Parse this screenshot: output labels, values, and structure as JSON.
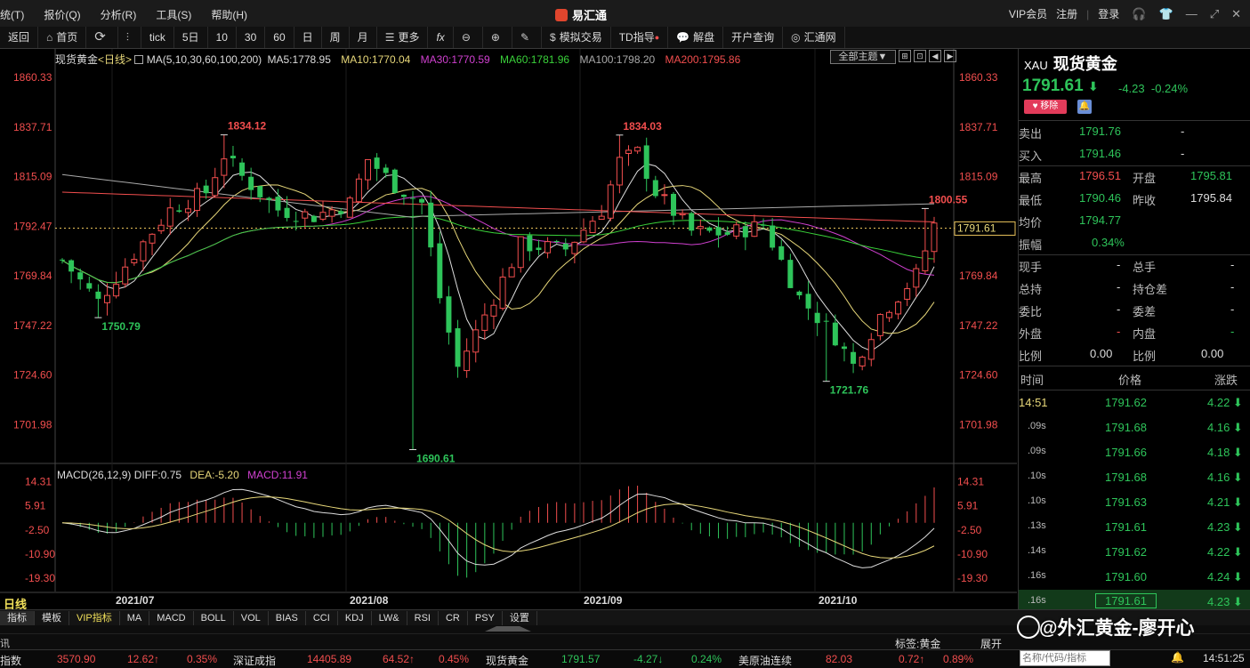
{
  "menu": [
    "统(T)",
    "报价(Q)",
    "分析(R)",
    "工具(S)",
    "帮助(H)"
  ],
  "app_title": "易汇通",
  "title_right": {
    "vip": "VIP会员",
    "register": "注册",
    "login": "登录"
  },
  "toolbar": {
    "items": [
      "返回",
      "首页",
      "",
      "",
      "tick",
      "5日",
      "10",
      "30",
      "60",
      "日",
      "周",
      "月",
      "更多",
      "fx",
      "",
      "",
      "",
      "模拟交易",
      "TD指导",
      "解盘",
      "开户查询",
      "汇通网"
    ]
  },
  "chart_header": {
    "symbol": "现货黄金",
    "period": "<日线>",
    "ma_label": "MA(5,10,30,60,100,200)",
    "ma5": "MA5:1778.95",
    "ma10": "MA10:1770.04",
    "ma30": "MA30:1770.59",
    "ma60": "MA60:1781.96",
    "ma100": "MA100:1798.20",
    "ma200": "MA200:1795.86",
    "theme_button": "全部主题▼"
  },
  "macd_header": {
    "label": "MACD(26,12,9)",
    "diff": "DIFF:0.75",
    "dea": "DEA:-5.20",
    "macd": "MACD:11.91"
  },
  "chart_data": {
    "type": "candlestick",
    "y_ticks": [
      "1860.33",
      "1837.71",
      "1815.09",
      "1792.47",
      "1769.84",
      "1747.22",
      "1724.60",
      "1701.98"
    ],
    "ylim": [
      1690,
      1866
    ],
    "x_labels": [
      "2021/07",
      "2021/08",
      "2021/09",
      "2021/10"
    ],
    "annotations": [
      {
        "text": "1834.12",
        "value": 1834.12,
        "idx": 18,
        "color": "red",
        "pos": "above"
      },
      {
        "text": "1750.79",
        "value": 1750.79,
        "idx": 4,
        "color": "green",
        "pos": "below"
      },
      {
        "text": "1690.61",
        "value": 1690.61,
        "idx": 39,
        "color": "green",
        "pos": "below"
      },
      {
        "text": "1834.03",
        "value": 1834.03,
        "idx": 62,
        "color": "red",
        "pos": "above"
      },
      {
        "text": "1800.55",
        "value": 1800.55,
        "idx": 96,
        "color": "red",
        "pos": "above"
      },
      {
        "text": "1721.76",
        "value": 1721.76,
        "idx": 85,
        "color": "green",
        "pos": "below"
      }
    ],
    "current_price": "1791.61",
    "current_value": 1791.61,
    "macd_ticks": [
      "14.31",
      "5.91",
      "-2.50",
      "-10.90",
      "-19.30"
    ],
    "macd_ylim": [
      -24,
      17
    ]
  },
  "quote": {
    "code": "XAU",
    "name": "现货黄金",
    "price": "1791.61",
    "arrow": "⬇",
    "change": "-4.23",
    "change_pct": "-0.24%",
    "remove_btn": "移除",
    "sell_label": "卖出",
    "sell": "1791.76",
    "sell_vol": "-",
    "buy_label": "买入",
    "buy": "1791.46",
    "buy_vol": "-",
    "high_label": "最高",
    "high": "1796.51",
    "open_label": "开盘",
    "open": "1795.81",
    "low_label": "最低",
    "low": "1790.46",
    "prev_label": "昨收",
    "prev": "1795.84",
    "avg_label": "均价",
    "avg": "1794.77",
    "amp_label": "振幅",
    "amp": "0.34%",
    "cur_hand_label": "现手",
    "cur_hand": "-",
    "total_hand_label": "总手",
    "total_hand": "-",
    "total_pos_label": "总持",
    "total_pos": "-",
    "pos_diff_label": "持仓差",
    "pos_diff": "-",
    "ratio_label": "委比",
    "ratio": "-",
    "diff_label": "委差",
    "diff": "-",
    "outer_label": "外盘",
    "outer": "-",
    "inner_label": "内盘",
    "inner": "-",
    "bili1_label": "比例",
    "bili1": "0.00",
    "bili2_label": "比例",
    "bili2": "0.00",
    "ticks_header": [
      "时间",
      "价格",
      "涨跌"
    ],
    "ticks": [
      {
        "time": "14:51",
        "price": "1791.62",
        "chg": "4.22"
      },
      {
        "time": ".09s",
        "price": "1791.68",
        "chg": "4.16"
      },
      {
        "time": ".09s",
        "price": "1791.66",
        "chg": "4.18"
      },
      {
        "time": ".10s",
        "price": "1791.68",
        "chg": "4.16"
      },
      {
        "time": ".10s",
        "price": "1791.63",
        "chg": "4.21"
      },
      {
        "time": ".13s",
        "price": "1791.61",
        "chg": "4.23"
      },
      {
        "time": ".14s",
        "price": "1791.62",
        "chg": "4.22"
      },
      {
        "time": ".16s",
        "price": "1791.60",
        "chg": "4.24"
      },
      {
        "time": ".16s",
        "price": "1791.61",
        "chg": "4.23"
      }
    ]
  },
  "period_tab": "日线",
  "indicator_tabs": [
    "指标",
    "模板",
    "VIP指标",
    "MA",
    "MACD",
    "BOLL",
    "VOL",
    "BIAS",
    "CCI",
    "KDJ",
    "LW&",
    "RSI",
    "CR",
    "PSY",
    "设置"
  ],
  "status": {
    "tag": "标签:黄金",
    "expand": "展开"
  },
  "search_placeholder": "名称/代码/指标",
  "watermark": "@外汇黄金-廖开心",
  "ticker": [
    {
      "t": "指数",
      "c": "white"
    },
    {
      "t": "3570.90",
      "c": "red"
    },
    {
      "t": "12.62↑",
      "c": "red"
    },
    {
      "t": "0.35%",
      "c": "red"
    },
    {
      "t": "深证成指",
      "c": "white"
    },
    {
      "t": "14405.89",
      "c": "red"
    },
    {
      "t": "64.52↑",
      "c": "red"
    },
    {
      "t": "0.45%",
      "c": "red"
    },
    {
      "t": "现货黄金",
      "c": "white"
    },
    {
      "t": "1791.57",
      "c": "green"
    },
    {
      "t": "-4.27↓",
      "c": "green"
    },
    {
      "t": "0.24%",
      "c": "green"
    },
    {
      "t": "美原油连续",
      "c": "white"
    },
    {
      "t": "82.03",
      "c": "red"
    },
    {
      "t": "0.72↑",
      "c": "red"
    },
    {
      "t": "0.89%",
      "c": "red"
    }
  ],
  "clock": "14:51:25"
}
